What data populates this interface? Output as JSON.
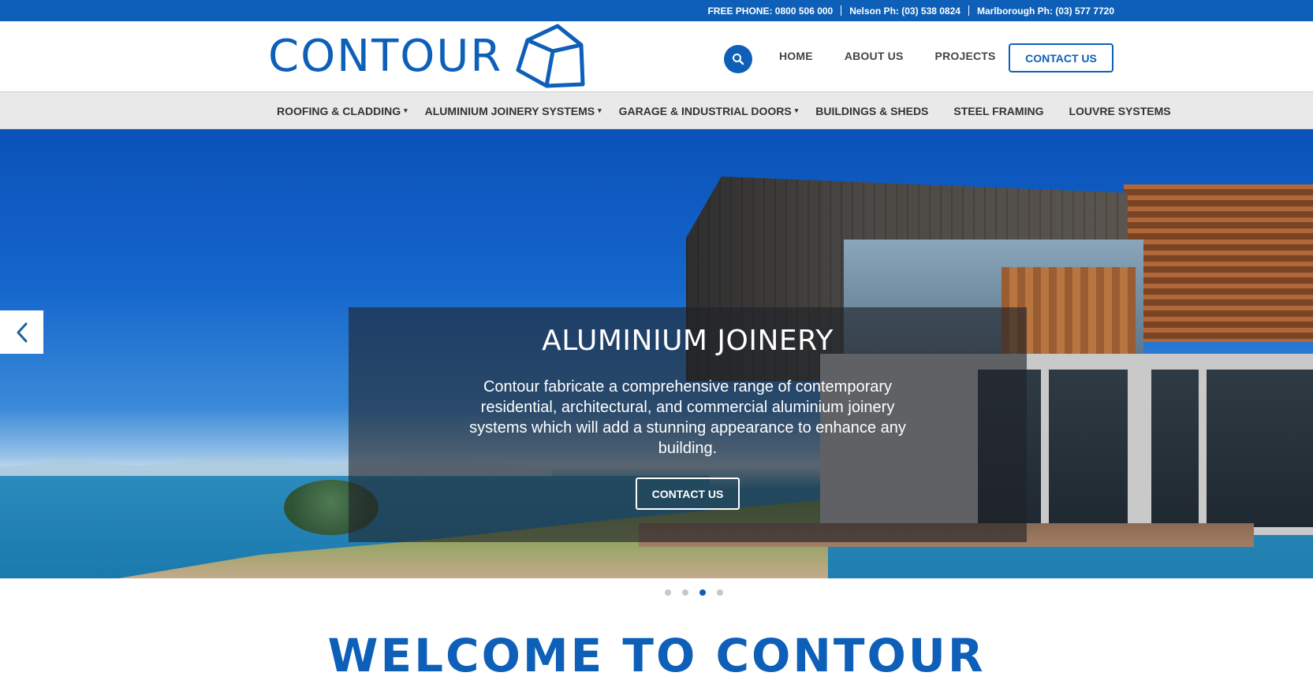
{
  "topbar": {
    "free_phone": "FREE PHONE: 0800 506 000",
    "nelson_phone": "Nelson Ph: (03) 538 0824",
    "marlborough_phone": "Marlborough Ph: (03) 577 7720"
  },
  "header": {
    "logo_text": "CONTOUR",
    "search_icon": "search-icon",
    "nav": [
      "HOME",
      "ABOUT US",
      "PROJECTS"
    ],
    "contact_button": "CONTACT US"
  },
  "subnav": {
    "items": [
      {
        "label": "ROOFING & CLADDING",
        "has_dropdown": true
      },
      {
        "label": "ALUMINIUM JOINERY SYSTEMS",
        "has_dropdown": true
      },
      {
        "label": "GARAGE & INDUSTRIAL DOORS",
        "has_dropdown": true
      },
      {
        "label": "BUILDINGS & SHEDS",
        "has_dropdown": false
      },
      {
        "label": "STEEL FRAMING",
        "has_dropdown": false
      },
      {
        "label": "LOUVRE SYSTEMS",
        "has_dropdown": false
      }
    ],
    "caret": "▾"
  },
  "hero": {
    "title": "ALUMINIUM JOINERY",
    "text": "Contour fabricate a comprehensive range of contemporary residential, architectural, and commercial aluminium joinery systems which will add a stunning appearance to enhance any building.",
    "button": "CONTACT US",
    "prev_icon": "chevron-left-icon",
    "slide_count": 4,
    "active_slide": 3
  },
  "welcome": {
    "heading": "WELCOME TO CONTOUR"
  },
  "colors": {
    "brand_blue": "#0d5fb8",
    "subnav_bg": "#e9e9e9"
  }
}
